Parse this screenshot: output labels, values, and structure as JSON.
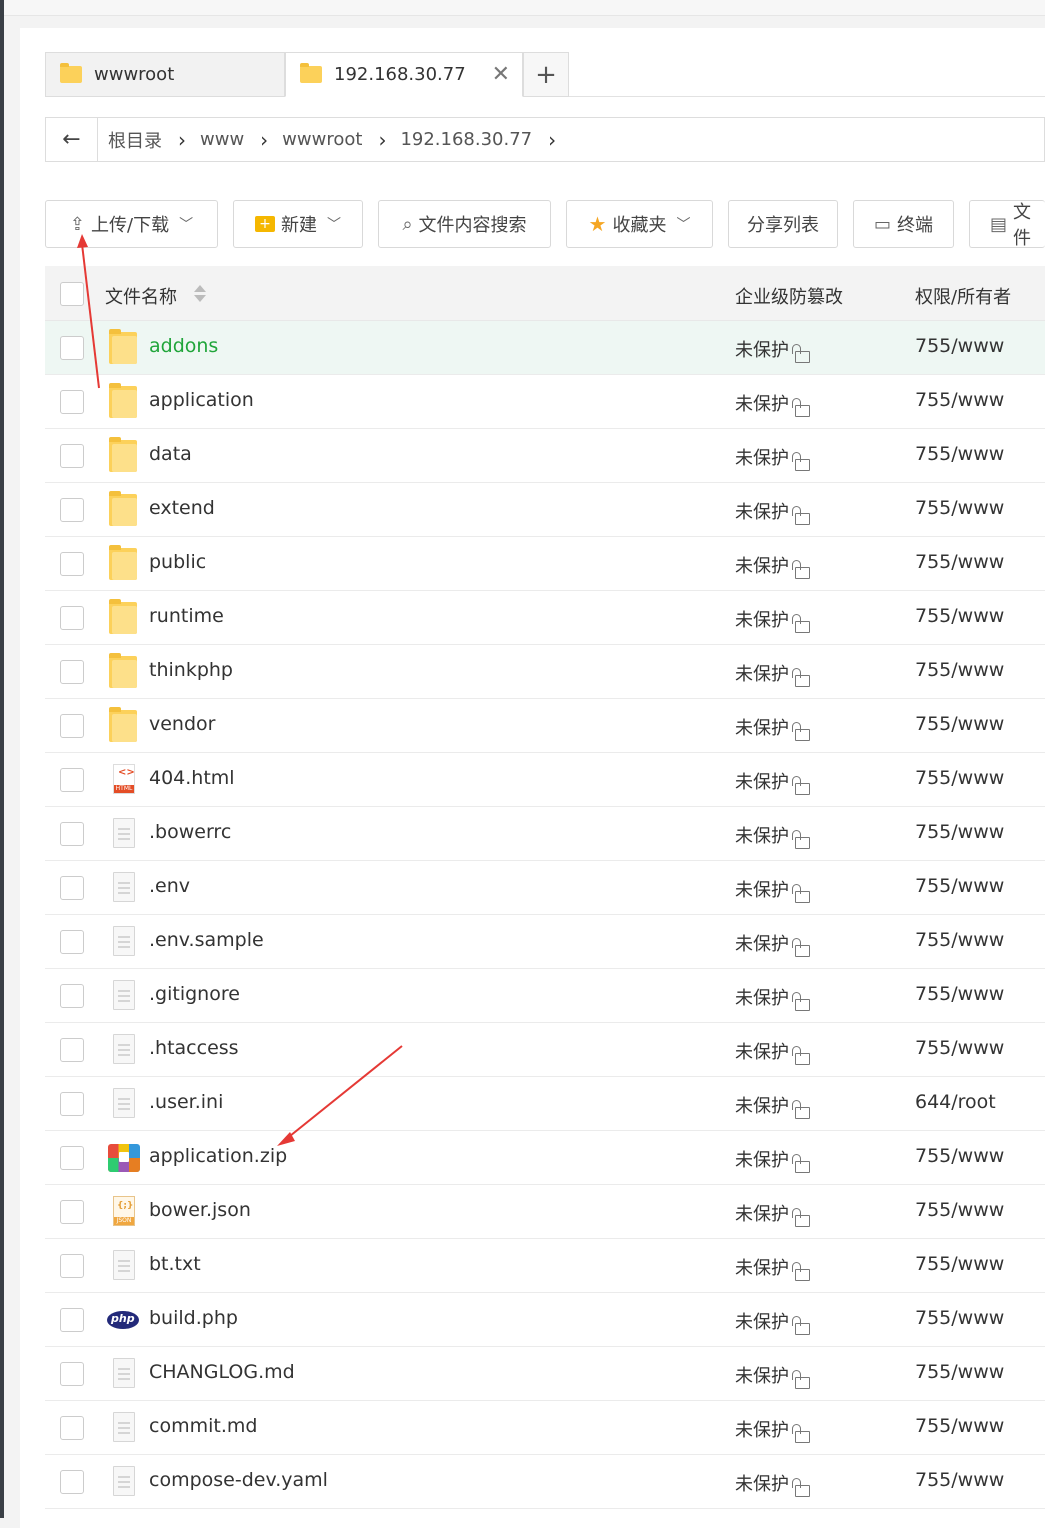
{
  "tabs": [
    {
      "label": "wwwroot"
    },
    {
      "label": "192.168.30.77"
    }
  ],
  "tab_add": "+",
  "breadcrumb": [
    "根目录",
    "www",
    "wwwroot",
    "192.168.30.77"
  ],
  "toolbar": {
    "upload_download": "上传/下载",
    "new": "新建",
    "content_search": "文件内容搜索",
    "favorites": "收藏夹",
    "share_list": "分享列表",
    "terminal": "终端",
    "more": "文件"
  },
  "table": {
    "headers": {
      "name": "文件名称",
      "protection": "企业级防篡改",
      "perm": "权限/所有者"
    },
    "rows": [
      {
        "name": "addons",
        "type": "folder",
        "protection": "未保护",
        "perm": "755/www"
      },
      {
        "name": "application",
        "type": "folder",
        "protection": "未保护",
        "perm": "755/www"
      },
      {
        "name": "data",
        "type": "folder",
        "protection": "未保护",
        "perm": "755/www"
      },
      {
        "name": "extend",
        "type": "folder",
        "protection": "未保护",
        "perm": "755/www"
      },
      {
        "name": "public",
        "type": "folder",
        "protection": "未保护",
        "perm": "755/www"
      },
      {
        "name": "runtime",
        "type": "folder",
        "protection": "未保护",
        "perm": "755/www"
      },
      {
        "name": "thinkphp",
        "type": "folder",
        "protection": "未保护",
        "perm": "755/www"
      },
      {
        "name": "vendor",
        "type": "folder",
        "protection": "未保护",
        "perm": "755/www"
      },
      {
        "name": "404.html",
        "type": "html",
        "protection": "未保护",
        "perm": "755/www"
      },
      {
        "name": ".bowerrc",
        "type": "file",
        "protection": "未保护",
        "perm": "755/www"
      },
      {
        "name": ".env",
        "type": "file",
        "protection": "未保护",
        "perm": "755/www"
      },
      {
        "name": ".env.sample",
        "type": "file",
        "protection": "未保护",
        "perm": "755/www"
      },
      {
        "name": ".gitignore",
        "type": "file",
        "protection": "未保护",
        "perm": "755/www"
      },
      {
        "name": ".htaccess",
        "type": "file",
        "protection": "未保护",
        "perm": "755/www"
      },
      {
        "name": ".user.ini",
        "type": "file",
        "protection": "未保护",
        "perm": "644/root"
      },
      {
        "name": "application.zip",
        "type": "zip",
        "protection": "未保护",
        "perm": "755/www"
      },
      {
        "name": "bower.json",
        "type": "json",
        "protection": "未保护",
        "perm": "755/www"
      },
      {
        "name": "bt.txt",
        "type": "file",
        "protection": "未保护",
        "perm": "755/www"
      },
      {
        "name": "build.php",
        "type": "php",
        "protection": "未保护",
        "perm": "755/www"
      },
      {
        "name": "CHANGLOG.md",
        "type": "file",
        "protection": "未保护",
        "perm": "755/www"
      },
      {
        "name": "commit.md",
        "type": "file",
        "protection": "未保护",
        "perm": "755/www"
      },
      {
        "name": "compose-dev.yaml",
        "type": "file",
        "protection": "未保护",
        "perm": "755/www"
      }
    ]
  },
  "colors": {
    "accent_green": "#20a53a",
    "annotation_red": "#e53935",
    "folder_yellow": "#fcd15a"
  }
}
